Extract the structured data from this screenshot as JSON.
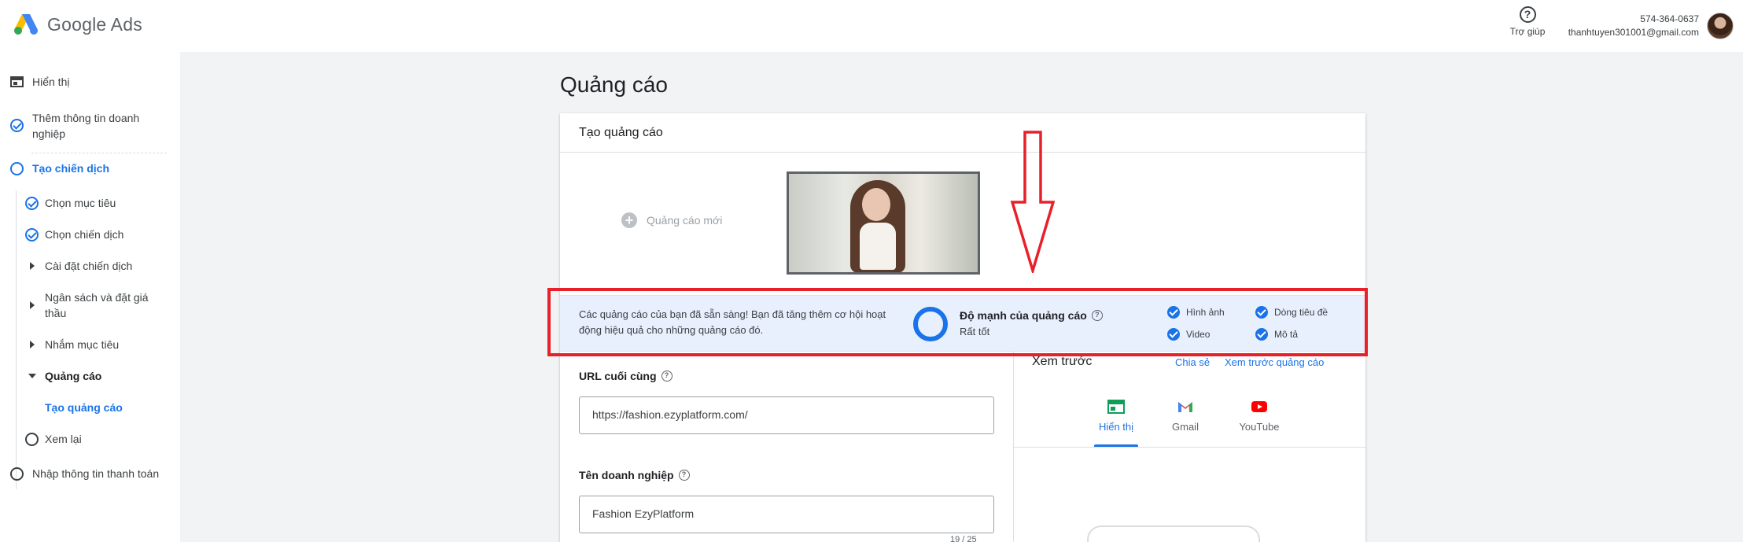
{
  "app": {
    "name": "Google Ads"
  },
  "header": {
    "help_label": "Trợ giúp",
    "account_id": "574-364-0637",
    "account_email": "thanhtuyen301001@gmail.com"
  },
  "sidebar": {
    "items": [
      {
        "label": "Hiển thị",
        "state": "view"
      },
      {
        "label": "Thêm thông tin doanh nghiệp",
        "state": "done"
      },
      {
        "label": "Tạo chiến dịch",
        "state": "current"
      },
      {
        "label": "Chọn mục tiêu",
        "state": "done"
      },
      {
        "label": "Chọn chiến dịch",
        "state": "done"
      },
      {
        "label": "Cài đặt chiến dịch",
        "state": "collapsed"
      },
      {
        "label": "Ngân sách và đặt giá thầu",
        "state": "collapsed"
      },
      {
        "label": "Nhắm mục tiêu",
        "state": "collapsed"
      },
      {
        "label": "Quảng cáo",
        "state": "expanded"
      },
      {
        "label": "Tạo quảng cáo",
        "state": "selected"
      },
      {
        "label": "Xem lại",
        "state": "todo"
      },
      {
        "label": "Nhập thông tin thanh toán",
        "state": "todo"
      }
    ]
  },
  "main": {
    "page_title": "Quảng cáo",
    "card_title": "Tạo quảng cáo",
    "new_ad_label": "Quảng cáo mới",
    "banner": {
      "message": "Các quảng cáo của bạn đã sẵn sàng! Bạn đã tăng thêm cơ hội hoạt động hiệu quả cho những quảng cáo đó.",
      "strength_title": "Độ mạnh của quảng cáo",
      "strength_value": "Rất tốt",
      "checks": [
        "Hình ảnh",
        "Dòng tiêu đề",
        "Video",
        "Mô tả"
      ]
    },
    "final_url": {
      "label": "URL cuối cùng",
      "value": "https://fashion.ezyplatform.com/"
    },
    "business_name": {
      "label": "Tên doanh nghiệp",
      "value": "Fashion EzyPlatform",
      "counter": "19 / 25"
    },
    "preview": {
      "title": "Xem trước",
      "share_link": "Chia sẻ",
      "preview_link": "Xem trước quảng cáo",
      "tabs": [
        "Hiển thị",
        "Gmail",
        "YouTube"
      ],
      "selected_tab": "Hiển thị"
    }
  },
  "colors": {
    "accent": "#1a73e8",
    "annotation": "#e8202a",
    "banner_bg": "#e8f0fe"
  }
}
